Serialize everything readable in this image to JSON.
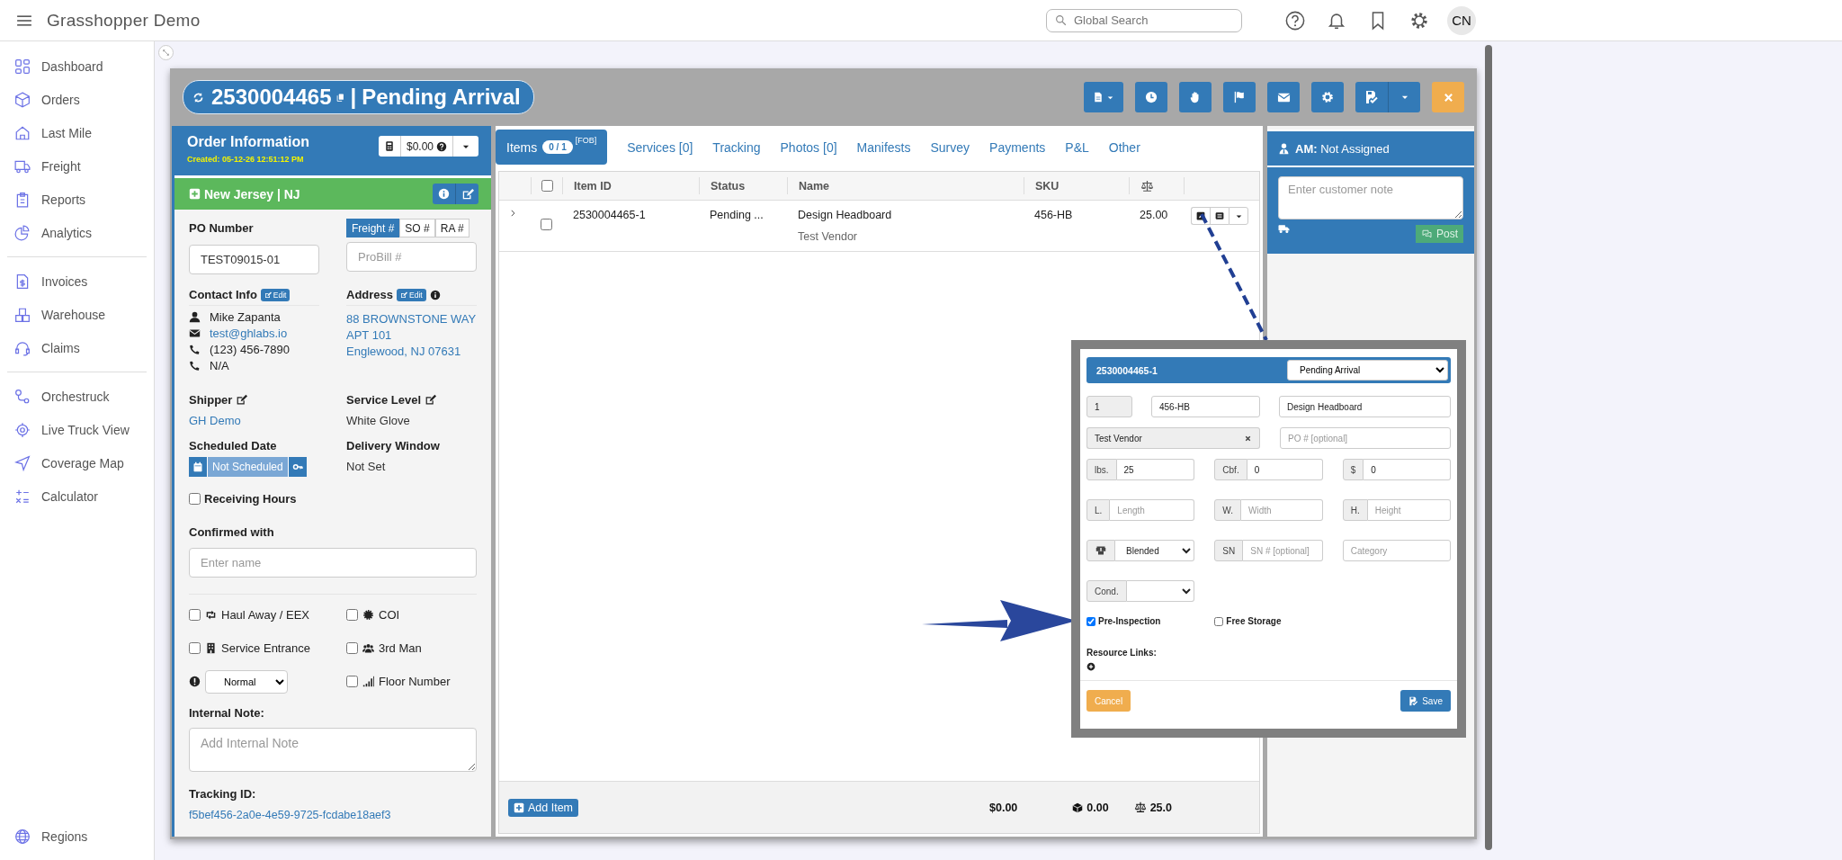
{
  "app": {
    "title": "Grasshopper Demo",
    "search": {
      "placeholder": "Global Search"
    },
    "avatar": "CN"
  },
  "sidebar": {
    "groups": [
      [
        "Dashboard",
        "Orders",
        "Last Mile",
        "Freight",
        "Reports",
        "Analytics"
      ],
      [
        "Invoices",
        "Warehouse",
        "Claims"
      ],
      [
        "Orchestruck",
        "Live Truck View",
        "Coverage Map",
        "Calculator"
      ]
    ],
    "footer": "Regions"
  },
  "order": {
    "number": "2530004465",
    "separator": "|",
    "status": "Pending Arrival"
  },
  "order_info": {
    "title": "Order Information",
    "created": "Created: 05-12-26 12:51:12 PM",
    "amount": "$0.00",
    "region": "New Jersey | NJ",
    "po": {
      "label": "PO Number",
      "value": "TEST09015-01"
    },
    "ref_tabs": [
      {
        "label": "Freight #",
        "selected": true
      },
      {
        "label": "SO #",
        "selected": false
      },
      {
        "label": "RA #",
        "selected": false
      }
    ],
    "probill": {
      "placeholder": "ProBill #"
    },
    "contact": {
      "label": "Contact Info",
      "edit": "Edit",
      "lines": [
        {
          "kind": "person",
          "text": "Mike Zapanta"
        },
        {
          "kind": "email",
          "text": "test@ghlabs.io"
        },
        {
          "kind": "phone",
          "text": "(123) 456-7890"
        },
        {
          "kind": "phone",
          "text": "N/A"
        }
      ]
    },
    "address": {
      "label": "Address",
      "edit": "Edit",
      "lines": [
        "88 BROWNSTONE WAY",
        "APT 101",
        "Englewood, NJ 07631"
      ]
    },
    "shipper": {
      "label": "Shipper",
      "value": "GH Demo"
    },
    "service_level": {
      "label": "Service Level",
      "value": "White Glove"
    },
    "scheduled_date": {
      "label": "Scheduled Date",
      "value": "Not Scheduled"
    },
    "delivery_window": {
      "label": "Delivery Window",
      "value": "Not Set"
    },
    "receiving_hours": {
      "label": "Receiving Hours",
      "checked": false
    },
    "confirmed_with": {
      "label": "Confirmed with",
      "placeholder": "Enter name"
    },
    "options": [
      {
        "label": "Haul Away / EEX",
        "checked": false
      },
      {
        "label": "COI",
        "checked": false
      },
      {
        "label": "Service Entrance",
        "checked": false
      },
      {
        "label": "3rd Man",
        "checked": false
      },
      {
        "label": "Floor Number",
        "checked": false
      }
    ],
    "priority": "Normal",
    "internal_note": {
      "label": "Internal Note:",
      "placeholder": "Add Internal Note"
    },
    "tracking": {
      "label": "Tracking ID:",
      "value": "f5bef456-2a0e-4e59-9725-fcdabe18aef3"
    }
  },
  "tabs": [
    {
      "label": "Items",
      "count": "0 / 1",
      "note": "[FOB]",
      "selected": true
    },
    {
      "label": "Services [0]",
      "selected": false
    },
    {
      "label": "Tracking",
      "selected": false
    },
    {
      "label": "Photos [0]",
      "selected": false
    },
    {
      "label": "Manifests",
      "selected": false
    },
    {
      "label": "Survey",
      "selected": false
    },
    {
      "label": "Payments",
      "selected": false
    },
    {
      "label": "P&L",
      "selected": false
    },
    {
      "label": "Other",
      "selected": false
    }
  ],
  "items_table": {
    "all_checked": false,
    "columns": [
      "Item ID",
      "Status",
      "Name",
      "SKU"
    ],
    "rows": [
      {
        "item_id": "2530004465-1",
        "status": "Pending ...",
        "name": "Design Headboard",
        "vendor": "Test Vendor",
        "sku": "456-HB",
        "weight": "25.00",
        "checked": false,
        "expanded": false
      }
    ],
    "footer": {
      "add_item": "Add Item",
      "total_value": "$0.00",
      "total_volume": "0.00",
      "total_weight": "25.0"
    }
  },
  "side_panel": {
    "am_label": "AM:",
    "am_value": "Not Assigned",
    "note_placeholder": "Enter customer note",
    "post": "Post"
  },
  "item_editor": {
    "item_id": "2530004465-1",
    "status": "Pending Arrival",
    "quantity": "1",
    "sku": "456-HB",
    "name": "Design Headboard",
    "vendor": "Test Vendor",
    "po_placeholder": "PO # [optional]",
    "rows": [
      [
        {
          "kind": "input",
          "prefix": "lbs.",
          "value": "25"
        },
        {
          "kind": "input",
          "prefix": "Cbf.",
          "value": "0"
        },
        {
          "kind": "input",
          "prefix": "$",
          "value": "0"
        }
      ],
      [
        {
          "kind": "input",
          "prefix": "L.",
          "placeholder": "Length"
        },
        {
          "kind": "input",
          "prefix": "W.",
          "placeholder": "Width"
        },
        {
          "kind": "input",
          "prefix": "H.",
          "placeholder": "Height"
        }
      ],
      [
        {
          "kind": "icon_select",
          "value": "Blended"
        },
        {
          "kind": "input",
          "prefix": "SN",
          "placeholder": "SN # [optional]"
        },
        {
          "kind": "plain",
          "placeholder": "Category"
        }
      ],
      [
        {
          "kind": "select",
          "prefix": "Cond."
        }
      ]
    ],
    "checks": [
      {
        "label": "Pre-Inspection",
        "checked": true
      },
      {
        "label": "Free Storage",
        "checked": false
      }
    ],
    "resource_links": "Resource Links:",
    "cancel": "Cancel",
    "save": "Save"
  }
}
